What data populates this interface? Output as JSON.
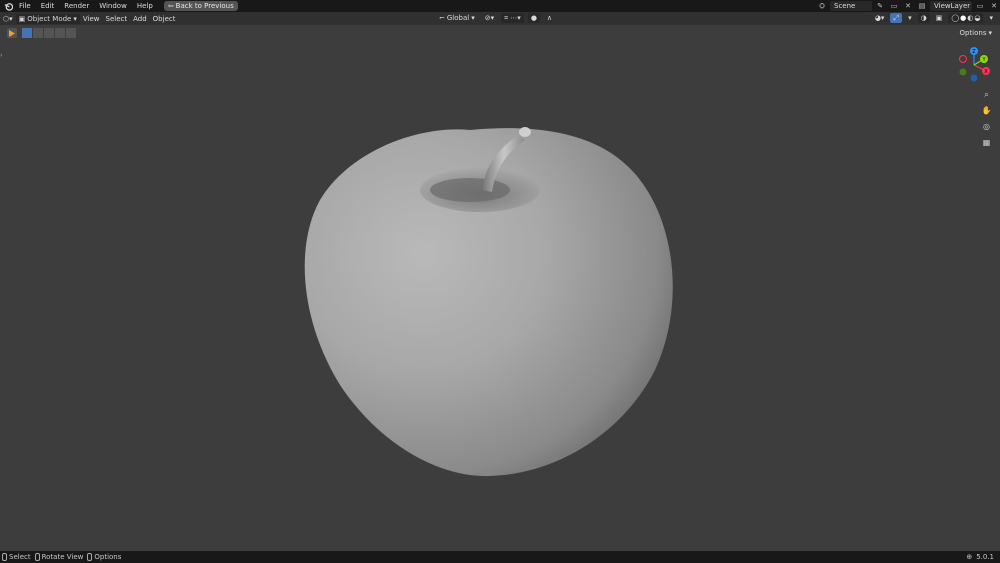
{
  "topbar": {
    "menu": [
      "File",
      "Edit",
      "Render",
      "Window",
      "Help"
    ],
    "back_button": "Back to Previous",
    "scene": "Scene",
    "view_layer": "ViewLayer"
  },
  "header": {
    "mode": "Object Mode",
    "menus": [
      "View",
      "Select",
      "Add",
      "Object"
    ],
    "orientation": "Global"
  },
  "toolbar": {
    "options_label": "Options"
  },
  "gizmo": {
    "axes": [
      "X",
      "Y",
      "Z"
    ],
    "colors": {
      "x": "#ff3352",
      "y": "#8bdc00",
      "z": "#2890ff"
    }
  },
  "statusbar": {
    "select": "Select",
    "rotate": "Rotate View",
    "options": "Options",
    "version": "5.0.1"
  }
}
